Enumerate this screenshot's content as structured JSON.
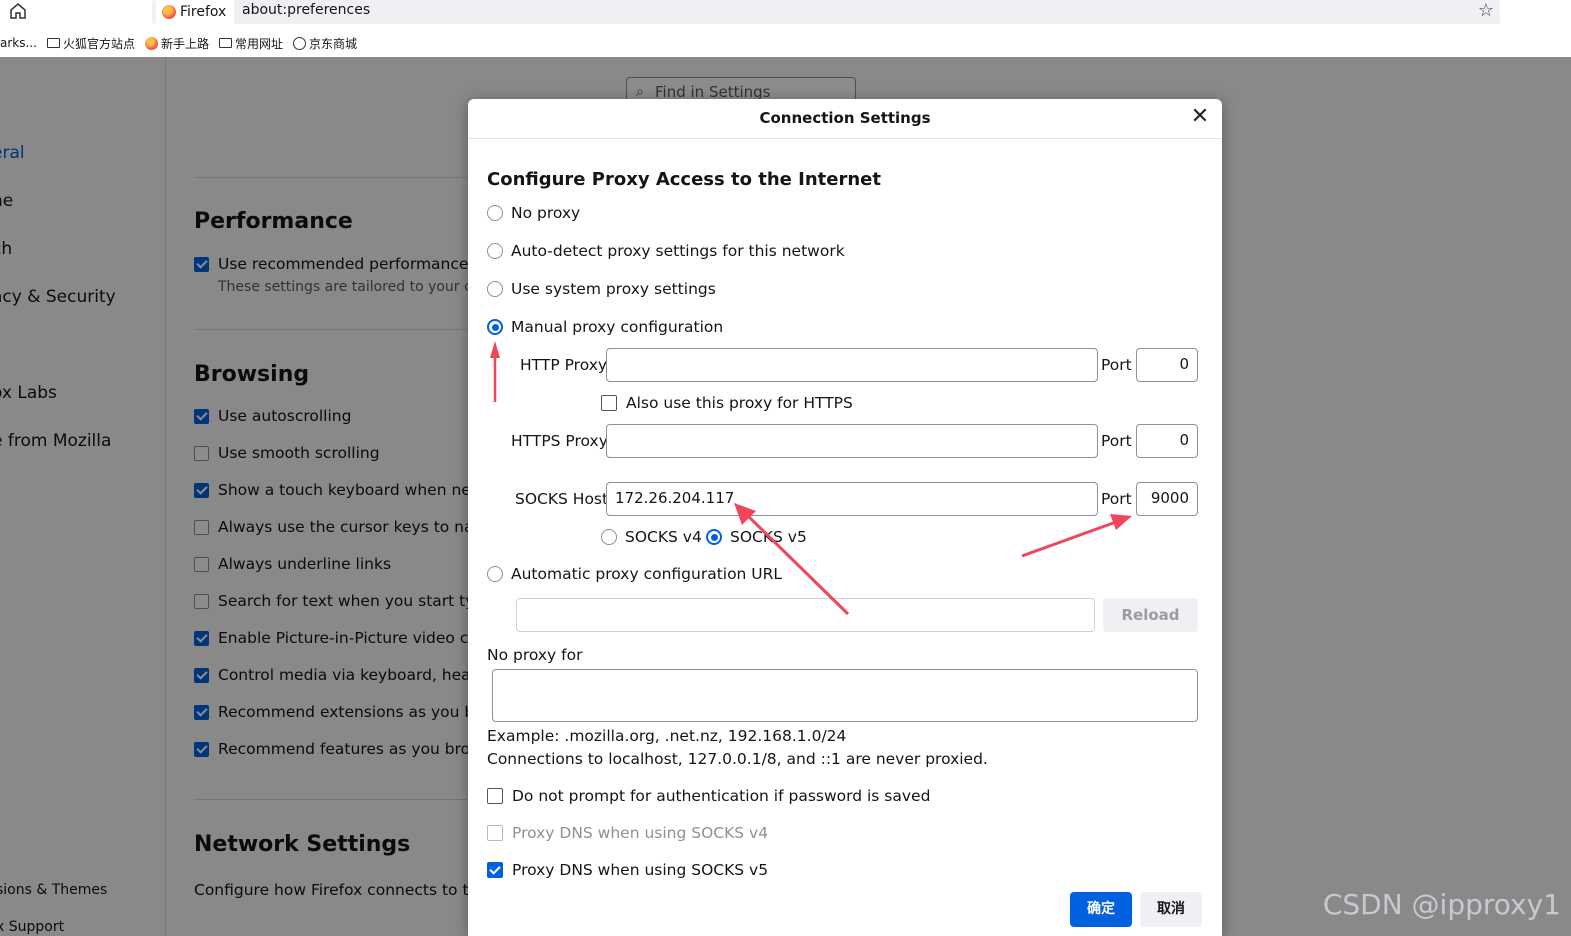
{
  "browser": {
    "tab_label": "Firefox",
    "url": "about:preferences",
    "bookmarks": [
      "arks...",
      "火狐官方站点",
      "新手上路",
      "常用网址",
      "京东商城"
    ]
  },
  "sidebar": {
    "items": [
      "eral",
      "ne",
      "ch",
      "acy & Security",
      "ox Labs",
      "e from Mozilla"
    ],
    "bottom": [
      "sions & Themes",
      "x Support"
    ]
  },
  "search": {
    "placeholder": "Find in Settings"
  },
  "prefs": {
    "performance": {
      "heading": "Performance",
      "item": "Use recommended performance se",
      "sub": "These settings are tailored to your com"
    },
    "browsing": {
      "heading": "Browsing",
      "items": [
        {
          "label": "Use autoscrolling",
          "checked": true
        },
        {
          "label": "Use smooth scrolling",
          "checked": false
        },
        {
          "label": "Show a touch keyboard when nece",
          "checked": true
        },
        {
          "label": "Always use the cursor keys to navig",
          "checked": false
        },
        {
          "label": "Always underline links",
          "checked": false
        },
        {
          "label": "Search for text when you start typir",
          "checked": false
        },
        {
          "label": "Enable Picture-in-Picture video con",
          "checked": true
        },
        {
          "label": "Control media via keyboard, heads",
          "checked": true
        },
        {
          "label": "Recommend extensions as you bro",
          "checked": true
        },
        {
          "label": "Recommend features as you brows",
          "checked": true
        }
      ]
    },
    "network": {
      "heading": "Network Settings",
      "sub": "Configure how Firefox connects to the"
    }
  },
  "dialog": {
    "title": "Connection Settings",
    "heading": "Configure Proxy Access to the Internet",
    "options": {
      "no_proxy": "No proxy",
      "auto_detect": "Auto-detect proxy settings for this network",
      "system": "Use system proxy settings",
      "manual": "Manual proxy configuration",
      "auto_url": "Automatic proxy configuration URL"
    },
    "selected_option": "manual",
    "http_proxy": {
      "label": "HTTP Proxy",
      "value": "",
      "port_label": "Port",
      "port": "0"
    },
    "also_https": "Also use this proxy for HTTPS",
    "https_proxy": {
      "label": "HTTPS Proxy",
      "value": "",
      "port_label": "Port",
      "port": "0"
    },
    "socks": {
      "label": "SOCKS Host",
      "value": "172.26.204.117",
      "port_label": "Port",
      "port": "9000"
    },
    "socks_v4": "SOCKS v4",
    "socks_v5": "SOCKS v5",
    "socks_version": "v5",
    "auto_url_value": "",
    "reload": "Reload",
    "no_proxy_for_label": "No proxy for",
    "no_proxy_for_value": "",
    "example": "Example: .mozilla.org, .net.nz, 192.168.1.0/24",
    "localhost_note": "Connections to localhost, 127.0.0.1/8, and ::1 are never proxied.",
    "no_prompt_auth": "Do not prompt for authentication if password is saved",
    "dns_v4": "Proxy DNS when using SOCKS v4",
    "dns_v5": "Proxy DNS when using SOCKS v5",
    "ok": "确定",
    "cancel": "取消"
  },
  "annotation_color": "#f0455a",
  "watermark": "CSDN @ipproxy1"
}
